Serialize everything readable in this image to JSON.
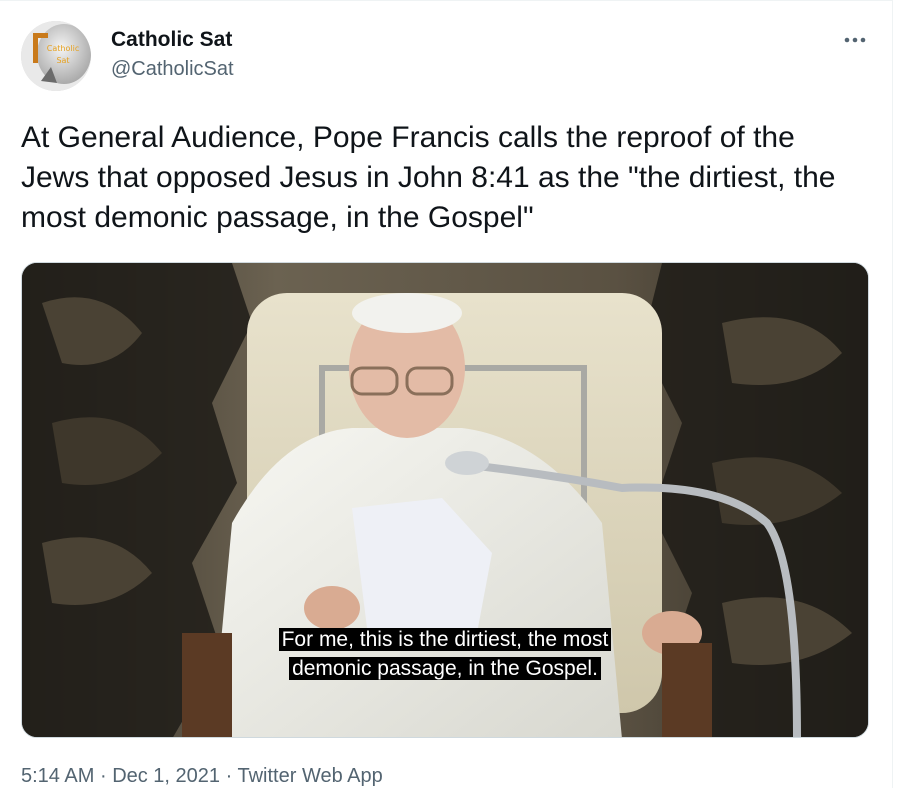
{
  "tweet": {
    "author": {
      "display_name": "Catholic Sat",
      "handle": "@CatholicSat",
      "avatar_text_line1": "Catholic",
      "avatar_text_line2": "Sat"
    },
    "more_icon": "more-horizontal-icon",
    "text": "At General Audience, Pope Francis calls the reproof of the Jews that opposed Jesus in John 8:41 as the \"the dirtiest, the most demonic passage, in the Gospel\"",
    "media": {
      "caption_line1": "For me, this is the dirtiest, the most",
      "caption_line2": "demonic passage, in the Gospel."
    },
    "meta": {
      "time": "5:14 AM",
      "separator": "·",
      "date": "Dec 1, 2021",
      "source": "Twitter Web App"
    }
  },
  "colors": {
    "text_primary": "#0f1419",
    "text_secondary": "#536471",
    "border": "#cfd9de"
  }
}
